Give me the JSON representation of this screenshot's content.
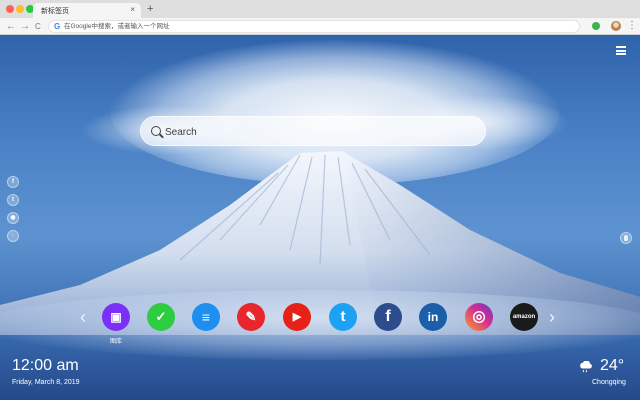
{
  "browser": {
    "tab_title": "新标签页",
    "tab_close": "×",
    "new_tab": "+",
    "back": "←",
    "forward": "→",
    "reload": "C",
    "omnibox_placeholder": "在Google中搜索，或者输入一个网址",
    "google_g": "G",
    "menu_glyph": "⋮",
    "traffic_colors": [
      "#fe5f57",
      "#febc2e",
      "#28c840"
    ]
  },
  "search": {
    "placeholder": "Search"
  },
  "side_social": [
    {
      "icon": "facebook-icon",
      "glyph": "f"
    },
    {
      "icon": "twitter-icon",
      "glyph": "t"
    },
    {
      "icon": "user-icon",
      "glyph": "◉"
    },
    {
      "icon": "wechat-icon",
      "glyph": "◌"
    }
  ],
  "apps": [
    {
      "icon": "gallery-icon",
      "glyph": "▣",
      "color": "#7b2ff7",
      "label": "图库"
    },
    {
      "icon": "tasks-icon",
      "glyph": "✓",
      "color": "#2ecc40"
    },
    {
      "icon": "notes-icon",
      "glyph": "≡",
      "color": "#1f8ef1"
    },
    {
      "icon": "paint-icon",
      "glyph": "✎",
      "color": "#e8262b"
    },
    {
      "icon": "youtube-icon",
      "glyph": "▶",
      "color": "#e62117"
    },
    {
      "icon": "twitter-icon",
      "glyph": "t",
      "color": "#1da1f2"
    },
    {
      "icon": "facebook-icon",
      "glyph": "f",
      "color": "#2d4c8e"
    },
    {
      "icon": "linkedin-icon",
      "glyph": "in",
      "color": "#1b5fa8"
    },
    {
      "icon": "instagram-icon",
      "glyph": "◎",
      "color": "#d62f8f"
    },
    {
      "icon": "amazon-icon",
      "glyph": "amazon",
      "color": "#1a1a1a"
    }
  ],
  "nav": {
    "prev": "‹",
    "next": "›"
  },
  "clock": {
    "time": "12:00 am",
    "date": "Friday, March 8, 2019"
  },
  "weather": {
    "temp": "24°",
    "city": "Chongqing",
    "icon": "cloud-rain-icon"
  }
}
